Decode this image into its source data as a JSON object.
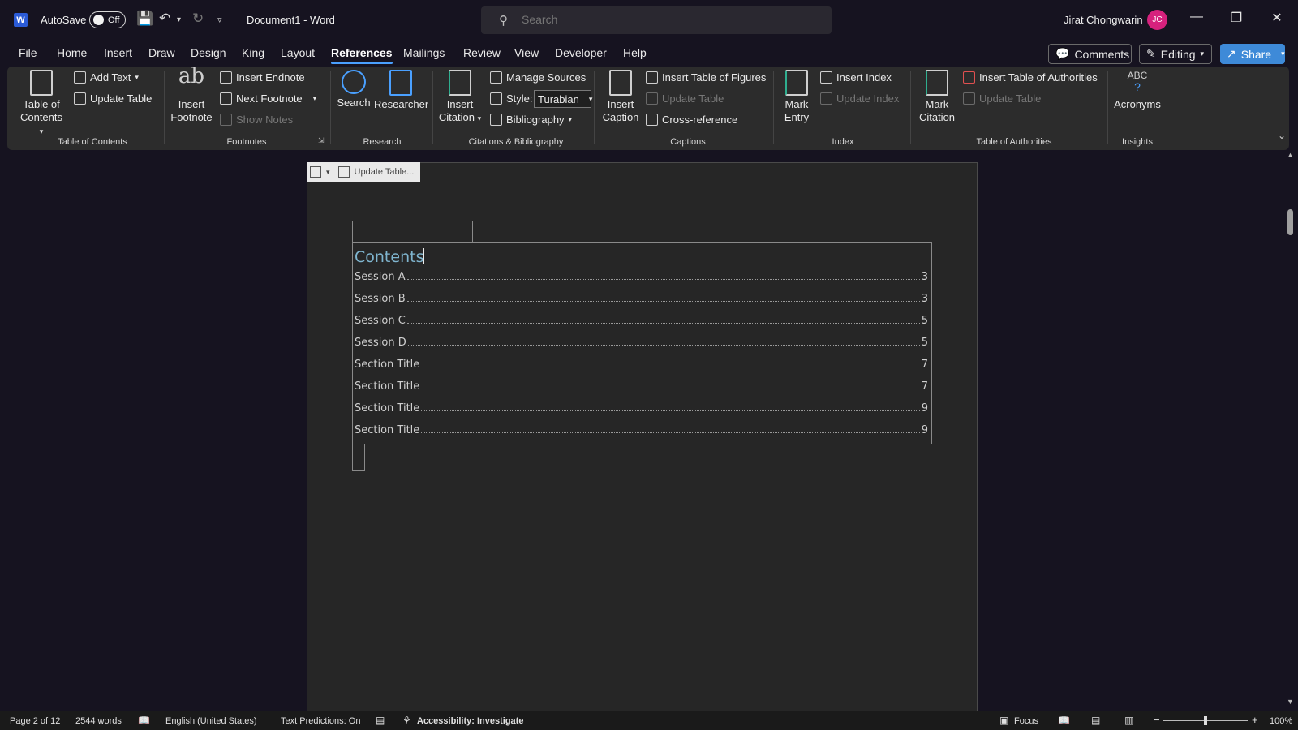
{
  "titlebar": {
    "autosave_label": "AutoSave",
    "autosave_state": "Off",
    "document_title": "Document1  -  Word",
    "search_placeholder": "Search",
    "user_name": "Jirat Chongwarin",
    "user_initials": "JC"
  },
  "menu": {
    "tabs": [
      "File",
      "Home",
      "Insert",
      "Draw",
      "Design",
      "King",
      "Layout",
      "References",
      "Mailings",
      "Review",
      "View",
      "Developer",
      "Help"
    ],
    "active_tab": "References",
    "comments_label": "Comments",
    "editing_label": "Editing",
    "share_label": "Share"
  },
  "ribbon": {
    "toc": {
      "table_of_contents_1": "Table of",
      "table_of_contents_2": "Contents",
      "add_text": "Add Text",
      "update_table": "Update Table",
      "group": "Table of Contents"
    },
    "footnotes": {
      "insert_footnote_1": "Insert",
      "insert_footnote_2": "Footnote",
      "insert_endnote": "Insert Endnote",
      "next_footnote": "Next Footnote",
      "show_notes": "Show Notes",
      "group": "Footnotes"
    },
    "research": {
      "search": "Search",
      "researcher": "Researcher",
      "group": "Research"
    },
    "citations": {
      "insert_citation_1": "Insert",
      "insert_citation_2": "Citation",
      "manage_sources": "Manage Sources",
      "style_label": "Style:",
      "style_value": "Turabian",
      "bibliography": "Bibliography",
      "group": "Citations & Bibliography"
    },
    "captions": {
      "insert_caption_1": "Insert",
      "insert_caption_2": "Caption",
      "insert_table_of_figures": "Insert Table of Figures",
      "update_table": "Update Table",
      "cross_reference": "Cross-reference",
      "group": "Captions"
    },
    "index": {
      "mark_entry_1": "Mark",
      "mark_entry_2": "Entry",
      "insert_index": "Insert Index",
      "update_index": "Update Index",
      "group": "Index"
    },
    "authorities": {
      "mark_citation_1": "Mark",
      "mark_citation_2": "Citation",
      "insert_table_of_authorities": "Insert Table of Authorities",
      "update_table": "Update Table",
      "group": "Table of Authorities"
    },
    "insights": {
      "abc": "ABC",
      "acronyms": "Acronyms",
      "group": "Insights"
    }
  },
  "document": {
    "toc_toolbar_update": "Update Table...",
    "toc_title": "Contents",
    "entries": [
      {
        "title": "Session A",
        "page": "3"
      },
      {
        "title": "Session B",
        "page": "3"
      },
      {
        "title": "Session C",
        "page": "5"
      },
      {
        "title": "Session D",
        "page": "5"
      },
      {
        "title": "Section Title",
        "page": "7"
      },
      {
        "title": "Section Title",
        "page": "7"
      },
      {
        "title": "Section Title",
        "page": "9"
      },
      {
        "title": "Section Title",
        "page": "9"
      }
    ]
  },
  "status": {
    "page": "Page 2 of 12",
    "words": "2544 words",
    "language": "English (United States)",
    "text_predictions": "Text Predictions: On",
    "accessibility": "Accessibility: Investigate",
    "focus": "Focus",
    "zoom": "100%"
  }
}
